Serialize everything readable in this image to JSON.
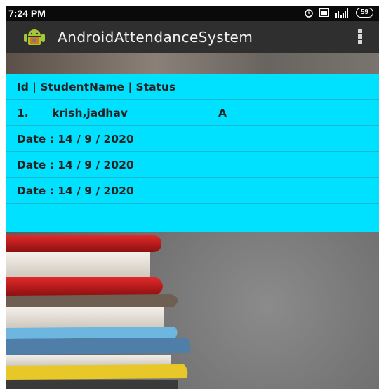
{
  "status_bar": {
    "time": "7:24 PM",
    "battery": "59"
  },
  "app_bar": {
    "title": "AndroidAttendanceSystem",
    "icon": "android-icon",
    "overflow_icon": "overflow-menu-icon"
  },
  "attendance_list": {
    "header": "Id | StudentName |  Status",
    "student": {
      "id": "1.",
      "name": "krish,jadhav",
      "status": "A"
    },
    "dates": [
      "Date : 14 / 9 / 2020",
      "Date : 14 / 9 / 2020",
      "Date : 14 / 9 / 2020"
    ]
  },
  "colors": {
    "list_background": "#00e0ff",
    "action_bar": "#2f2f2f",
    "status_bar": "#0a0a0a"
  }
}
